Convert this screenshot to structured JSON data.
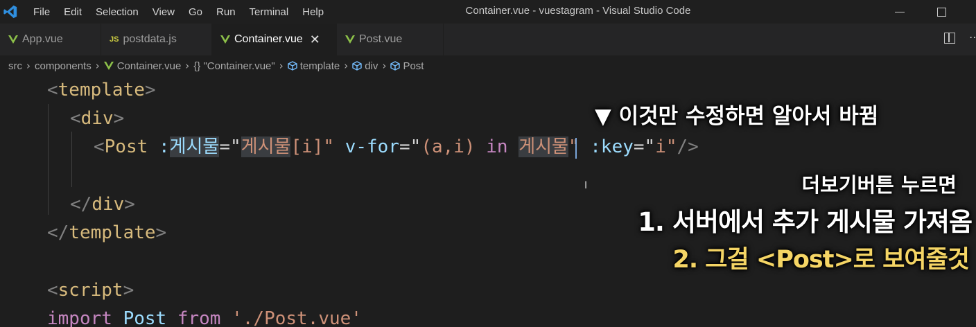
{
  "titlebar": {
    "menu": [
      "File",
      "Edit",
      "Selection",
      "View",
      "Go",
      "Run",
      "Terminal",
      "Help"
    ],
    "window_title": "Container.vue - vuestagram - Visual Studio Code"
  },
  "tabs": [
    {
      "label": "App.vue",
      "icon": "vue-icon",
      "active": false
    },
    {
      "label": "postdata.js",
      "icon": "js-icon",
      "icon_text": "JS",
      "active": false
    },
    {
      "label": "Container.vue",
      "icon": "vue-icon",
      "active": true,
      "close": "✕"
    },
    {
      "label": "Post.vue",
      "icon": "vue-icon",
      "active": false
    }
  ],
  "breadcrumb": {
    "items": [
      "src",
      "components",
      "Container.vue",
      "{} \"Container.vue\"",
      "template",
      "div",
      "Post"
    ]
  },
  "code": {
    "l1_tag": "template",
    "l2_tag": "div",
    "l3": {
      "tag": "Post",
      "attr1": ":",
      "attr1_name": "게시물",
      "eq1": "=\"",
      "val1_hl": "게시물",
      "val1_rest": "[i]\"",
      "attr2": "v-for",
      "eq2": "=\"",
      "val2a": "(a,i) ",
      "val2_kw": "in",
      "val2b_hl": "게시물",
      "val2c": "\"",
      "attr3": ":key",
      "eq3": "=\"",
      "val3": "i\"",
      "close": "/>"
    },
    "l5_tag": "div",
    "l6_tag": "template",
    "l8_tag": "script",
    "l9": {
      "kw1": "import",
      "name": " Post ",
      "kw2": "from",
      "str": " './Post.vue'"
    }
  },
  "captions": {
    "c1": "▼ 이것만 수정하면 알아서 바뀜",
    "c2": "더보기버튼 누르면",
    "c3": "1. 서버에서 추가 게시물 가져옴",
    "c4": "2. 그걸 <Post>로 보여줄것"
  },
  "colors": {
    "background": "#1e1e1e",
    "tag": "#569cd6",
    "attribute": "#9cdcfe",
    "string": "#ce9178",
    "keyword": "#c586c0",
    "caption_highlight": "#f5d565"
  }
}
